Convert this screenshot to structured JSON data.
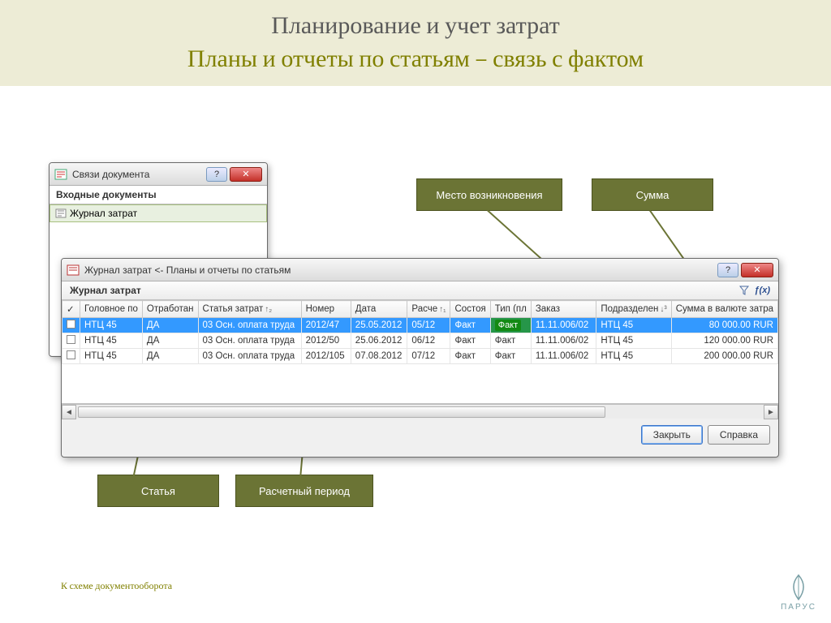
{
  "header": {
    "title1": "Планирование и учет затрат",
    "title2": "Планы и отчеты по статьям – связь с фактом"
  },
  "callouts": {
    "place": "Место возникновения",
    "sum": "Сумма",
    "article": "Статья",
    "period": "Расчетный период"
  },
  "small_window": {
    "title": "Связи документа",
    "section": "Входные документы",
    "item": "Журнал затрат"
  },
  "large_window": {
    "title": "Журнал затрат <- Планы и отчеты по статьям",
    "section": "Журнал затрат",
    "fx": "ƒ(x)",
    "columns": {
      "check": "✓",
      "head": "Головное по",
      "processed": "Отработан",
      "article": "Статья затрат",
      "number": "Номер",
      "date": "Дата",
      "period": "Расче",
      "state": "Состоя",
      "type": "Тип (пл",
      "order": "Заказ",
      "dept": "Подразделен",
      "amount": "Сумма в валюте затра"
    },
    "rows": [
      {
        "head": "НТЦ 45",
        "processed": "ДА",
        "article": "03 Осн. оплата труда",
        "number": "2012/47",
        "date": "25.05.2012",
        "period": "05/12",
        "state": "Факт",
        "type": "Факт",
        "order": "11.11.006/02",
        "dept": "НТЦ 45",
        "amount": "80 000.00 RUR"
      },
      {
        "head": "НТЦ 45",
        "processed": "ДА",
        "article": "03 Осн. оплата труда",
        "number": "2012/50",
        "date": "25.06.2012",
        "period": "06/12",
        "state": "Факт",
        "type": "Факт",
        "order": "11.11.006/02",
        "dept": "НТЦ 45",
        "amount": "120 000.00 RUR"
      },
      {
        "head": "НТЦ 45",
        "processed": "ДА",
        "article": "03 Осн. оплата труда",
        "number": "2012/105",
        "date": "07.08.2012",
        "period": "07/12",
        "state": "Факт",
        "type": "Факт",
        "order": "11.11.006/02",
        "dept": "НТЦ 45",
        "amount": "200 000.00 RUR"
      }
    ],
    "buttons": {
      "close": "Закрыть",
      "help": "Справка"
    }
  },
  "footer": {
    "link": "К схеме документооборота",
    "brand": "ПАРУС"
  }
}
